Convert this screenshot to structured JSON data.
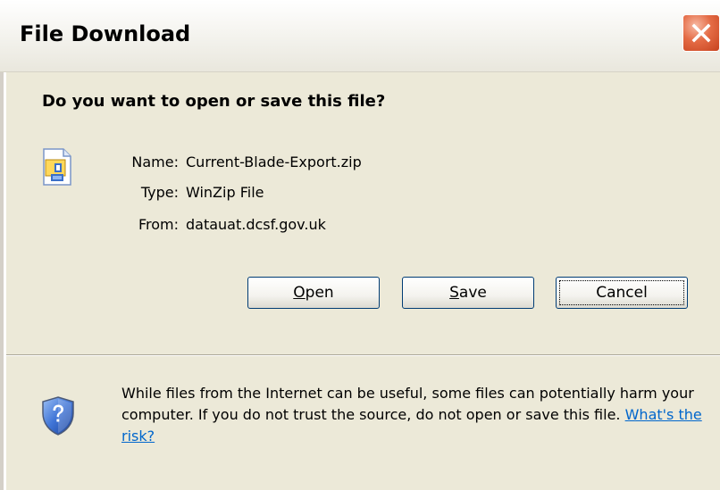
{
  "window": {
    "title": "File Download"
  },
  "dialog": {
    "question": "Do you want to open or save this file?",
    "file": {
      "name_label": "Name:",
      "name_value": "Current-Blade-Export.zip",
      "type_label": "Type:",
      "type_value": "WinZip File",
      "from_label": "From:",
      "from_value": "datauat.dcsf.gov.uk",
      "icon": "zip-file-icon"
    },
    "buttons": {
      "open_label_first": "O",
      "open_label_rest": "pen",
      "save_label_first": "S",
      "save_label_rest": "ave",
      "cancel_label": "Cancel"
    },
    "warning": {
      "icon": "shield-question-icon",
      "text": "While files from the Internet can be useful, some files can potentially harm your computer. If you do not trust the source, do not open or save this file.",
      "link_text": "What's the risk?"
    }
  },
  "colors": {
    "dialog_background": "#ece9d8",
    "close_button": "#e46b45",
    "link": "#0066cc",
    "button_border": "#003c74"
  }
}
